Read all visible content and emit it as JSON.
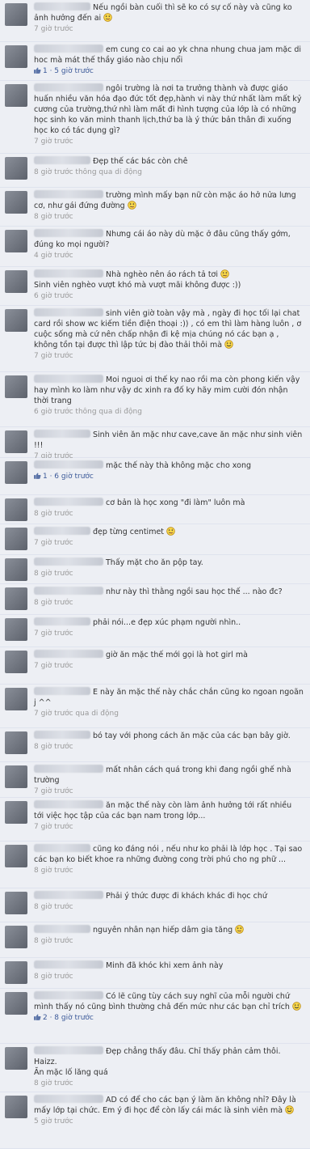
{
  "comments": [
    {
      "text": "Nếu ngồi bàn cuối thì sẽ ko có sự cố này và cũng ko ảnh hưởng đến ai",
      "emoticon": "tongue-emoticon",
      "time": "7 giờ trước",
      "likes": ""
    },
    {
      "text": "em cung co cai ao yk chna nhung chua jam mặc di hoc mà mát thế thầy giáo nào chịu nổi",
      "emoticon": "",
      "time": "1 · 5 giờ trước",
      "likes": "1"
    },
    {
      "text": "ngôi trường là nơi ta trưởng thành và được giáo huấn nhiều văn hóa đạo đức tốt đẹp,hành vi này thứ nhất làm mất kỷ cương của trường,thứ nhì làm mất đi hình tượng của lớp là có những học sinh ko văn minh thanh lịch,thứ ba là ý thức bản thân đi xuống học ko có tác dụng gì?",
      "emoticon": "",
      "time": "7 giờ trước",
      "likes": ""
    },
    {
      "text": "Đẹp thế các bác còn chê",
      "emoticon": "",
      "time": "8 giờ trước thông qua di động",
      "likes": ""
    },
    {
      "text": "trường mình mấy bạn nữ còn mặc áo hở nửa lưng cơ, như gái đứng đường",
      "emoticon": "tongue-emoticon",
      "time": "8 giờ trước",
      "likes": ""
    },
    {
      "text": "Nhưng cái áo này dù mặc ở đâu cũng thấy gớm, đúng ko mọi người?",
      "emoticon": "",
      "time": "4 giờ trước",
      "likes": ""
    },
    {
      "text": "Nhà nghèo nên áo rách tả tơi",
      "emoticon": "tongue-emoticon",
      "text2": "Sinh viên nghèo vượt khó mà vượt mãi không được :))",
      "time": "6 giờ trước",
      "likes": ""
    },
    {
      "text": "sinh viên giờ toàn vậy mà , ngày đi học tối lại chat card rồi show wc kiếm tiền điện thoại :)) , có em thì làm hàng luôn , ơ cuộc sống mà cứ nên chấp nhận đi kệ mịa chúng nó các bạn ạ , không tồn tại được thì lập tức bị đào thải thôi mà",
      "emoticon": "smile-emoticon",
      "time": "7 giờ trước",
      "likes": ""
    },
    {
      "text": "Moi nguoi ơi thế ky nao rồi ma còn phong kiến vậy hay mình ko làm như vậy dc xinh ra đố ky hãy mim cười đón nhận thời trang",
      "emoticon": "",
      "time": "6 giờ trước thông qua di động",
      "likes": ""
    },
    {
      "text": "Sinh viên ăn mặc như cave,cave ăn mặc như sinh viên !!!",
      "emoticon": "",
      "time": "7 giờ trước",
      "likes": ""
    },
    {
      "text": "mặc thế này thà không mặc cho xong",
      "emoticon": "",
      "time": "1 · 6 giờ trước",
      "likes": "1"
    },
    {
      "text": "cơ bản là học xong \"đi làm\" luôn mà",
      "emoticon": "",
      "time": "8 giờ trước",
      "likes": ""
    },
    {
      "text": "đẹp từng centimet",
      "emoticon": "tongue-emoticon",
      "time": "7 giờ trước",
      "likes": ""
    },
    {
      "text": "Thấy mặt cho ăn pộp tay.",
      "emoticon": "",
      "time": "8 giờ trước",
      "likes": ""
    },
    {
      "text": "như này thì thằng ngồi sau học thế ... nào đc?",
      "emoticon": "",
      "time": "8 giờ trước",
      "likes": ""
    },
    {
      "text": "phải nói...e đẹp xúc phạm người nhìn..",
      "emoticon": "",
      "time": "7 giờ trước",
      "likes": ""
    },
    {
      "text": "giờ ăn mặc thế mới gọi là hot girl mà",
      "emoticon": "",
      "time": "7 giờ trước",
      "likes": ""
    },
    {
      "text": "E này ăn mặc thế này chắc chắn cũng ko ngoan ngoãn j ^^",
      "emoticon": "",
      "time": "7 giờ trước qua di động",
      "likes": ""
    },
    {
      "text": "bó tay với phong cách ăn mặc của các bạn bây giờ.",
      "emoticon": "",
      "time": "8 giờ trước",
      "likes": ""
    },
    {
      "text": "mất nhân cách quá trong khi đang ngồi ghế nhà trường",
      "emoticon": "",
      "time": "7 giờ trước",
      "likes": ""
    },
    {
      "text": "ăn mặc thế này còn làm ảnh hưởng tới rất nhiều tới việc học tập của các bạn nam trong lớp...",
      "emoticon": "",
      "time": "7 giờ trước",
      "likes": ""
    },
    {
      "text": "cũng ko đáng nói , nếu như ko phải là lớp học . Tại sao các bạn ko biết khoe ra những đường cong trời phú cho ng phữ ...",
      "emoticon": "",
      "time": "8 giờ trước",
      "likes": ""
    },
    {
      "text": "Phải ý thức được đi khách khác đi học chứ",
      "emoticon": "",
      "time": "8 giờ trước",
      "likes": ""
    },
    {
      "text": "nguyên nhân nạn hiếp dâm gia tăng",
      "emoticon": "tongue-emoticon",
      "time": "8 giờ trước",
      "likes": ""
    },
    {
      "text": "Minh đã khóc khi xem ảnh này",
      "emoticon": "",
      "time": "8 giờ trước",
      "likes": ""
    },
    {
      "text": "Có lẽ cũng tùy cách suy nghĩ của mỗi người chứ mình thấy nó cũng bình thường chả đến mức như các bạn chỉ trích",
      "emoticon": "smile-emoticon",
      "time": "2 · 8 giờ trước",
      "likes": "2"
    },
    {
      "text": "Đẹp chẳng thấy đâu. Chỉ thấy phản cảm thôi.",
      "emoticon": "",
      "text2": "Haizz.",
      "text3": "Ăn mặc lố lăng quá",
      "time": "8 giờ trước",
      "likes": ""
    },
    {
      "text": "AD có để cho các bạn ý làm ăn không nhỉ? Đây là mấy lớp tại chức. Em ý đi học để còn lấy cái mác là sinh viên mà",
      "emoticon": "smile-emoticon",
      "time": "5 giờ trước",
      "likes": ""
    }
  ],
  "colors": {
    "background": "#edeff4",
    "link": "#3b5998",
    "meta": "#999999",
    "text": "#333333"
  }
}
